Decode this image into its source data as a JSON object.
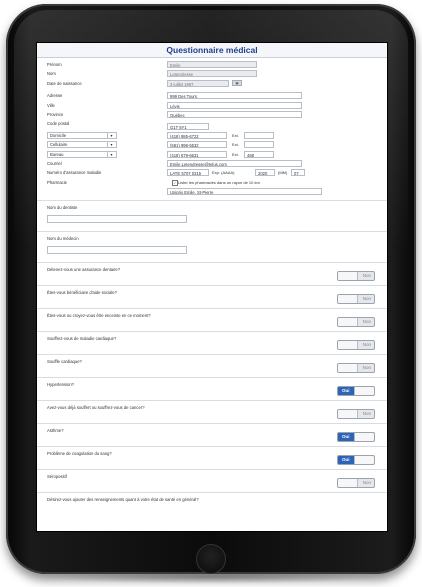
{
  "form": {
    "title": "Questionnaire médical",
    "fields": {
      "prenom": {
        "label": "Prénom",
        "value": "Emile"
      },
      "nom": {
        "label": "Nom",
        "value": "Letendresse"
      },
      "naissance": {
        "label": "Date de naissance",
        "value": "3 juillet 1997"
      },
      "adresse": {
        "label": "Adresse",
        "value": "999 Des Tours"
      },
      "ville": {
        "label": "Ville",
        "value": "Lévis"
      },
      "province": {
        "label": "Province",
        "value": "Québec"
      },
      "code_postal": {
        "label": "Code postal",
        "value": "G1T 5Y1"
      },
      "courriel": {
        "label": "Courriel",
        "value": "Emile.Letendresse@telus.com"
      },
      "nas": {
        "label": "Numéro d'assurance maladie",
        "value": "LATE 5707 0315",
        "exp_label": "Exp. (AAAA)",
        "exp_year": "2020",
        "mm_label": "(MM)",
        "mm_value": "07"
      },
      "pharmacie": {
        "label": "Pharmacie",
        "checkbox_text": "Lister les pharmacies dans un rayon de 10 km",
        "value": "Uniprix Emile, St-Pierre"
      }
    },
    "phones": [
      {
        "type": "Domicile",
        "number": "(418) 985-6722",
        "ext_label": "Ext.",
        "ext": ""
      },
      {
        "type": "Cellulaire",
        "number": "(581) 996-5532",
        "ext_label": "Ext.",
        "ext": ""
      },
      {
        "type": "Bureau",
        "number": "(418) 679-6631",
        "ext_label": "Ext.",
        "ext": "468"
      }
    ],
    "text_sections": {
      "dentiste": "Nom du dentiste",
      "medecin": "Nom du médecin"
    },
    "questions": [
      {
        "label": "Détenez-vous une assurance dentaire?",
        "answer": "Non"
      },
      {
        "label": "Êtes-vous bénéficiaire d'aide sociale?",
        "answer": "Non"
      },
      {
        "label": "Êtes-vous ou croyez-vous être enceinte en ce moment?",
        "answer": "Non"
      },
      {
        "label": "Souffrez-vous de maladie cardiaque?",
        "answer": "Non"
      },
      {
        "label": "Souffle cardiaque?",
        "answer": "Non"
      },
      {
        "label": "Hypertension?",
        "answer": "Oui"
      },
      {
        "label": "Avez-vous déjà souffert ou souffrez-vous de cancer?",
        "answer": "Non"
      },
      {
        "label": "Asthme?",
        "answer": "Oui"
      },
      {
        "label": "Problème de coagulation du sang?",
        "answer": "Oui"
      },
      {
        "label": "Séropositif",
        "answer": "Non"
      }
    ],
    "footer_question": "Désirez-vous ajouter des renseignements quant à votre état de santé en général?"
  }
}
